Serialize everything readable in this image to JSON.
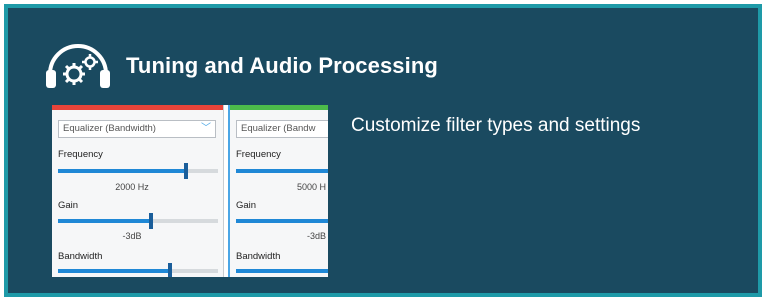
{
  "header": {
    "title": "Tuning and Audio Processing",
    "icon": "headphones-gear-icon"
  },
  "description": "Customize filter types and settings",
  "thumbnail": {
    "panels": [
      {
        "accent_color": "#e8443a",
        "dropdown": "Equalizer (Bandwidth)",
        "frequency_label": "Frequency",
        "frequency_value": "2000 Hz",
        "frequency_level": 0.8,
        "gain_label": "Gain",
        "gain_value": "-3dB",
        "gain_level": 0.58,
        "bandwidth_label": "Bandwidth",
        "bandwidth_level": 0.7
      },
      {
        "accent_color": "#4cbb4a",
        "dropdown": "Equalizer (Bandw",
        "frequency_label": "Frequency",
        "frequency_value": "5000 H",
        "frequency_level": 1.0,
        "gain_label": "Gain",
        "gain_value": "-3dB",
        "gain_level": 1.0,
        "bandwidth_label": "Bandwidth",
        "bandwidth_level": 1.0
      }
    ]
  },
  "colors": {
    "card_bg": "#1a4a60",
    "card_border": "#1e9aa8",
    "slider_fill": "#1f88d6"
  }
}
